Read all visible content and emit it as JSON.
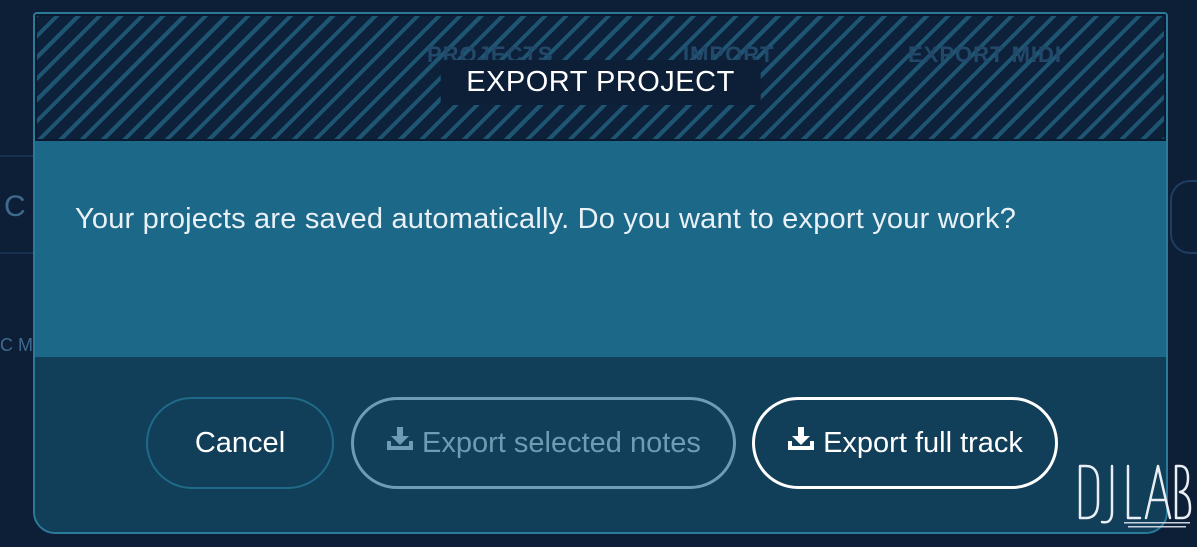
{
  "background_app": {
    "tabs": [
      "PROJECTS",
      "IMPORT",
      "EXPORT MIDI"
    ],
    "edge_letters": [
      "C",
      "C M"
    ]
  },
  "modal": {
    "title": "EXPORT PROJECT",
    "message": "Your projects are saved automatically. Do you want to export your work?",
    "buttons": {
      "cancel": "Cancel",
      "export_selected": "Export selected notes",
      "export_full": "Export full track"
    },
    "icons": {
      "export_selected": "download-icon",
      "export_full": "download-icon"
    }
  },
  "watermark": {
    "logo_text": "DJ LAB"
  },
  "colors": {
    "page_background": "#0d1e37",
    "modal_border": "#2b7a9a",
    "modal_body": "#1c6888",
    "modal_footer": "#113e58",
    "disabled_button": "#6f9cb4",
    "primary_button_border": "#ffffff"
  }
}
